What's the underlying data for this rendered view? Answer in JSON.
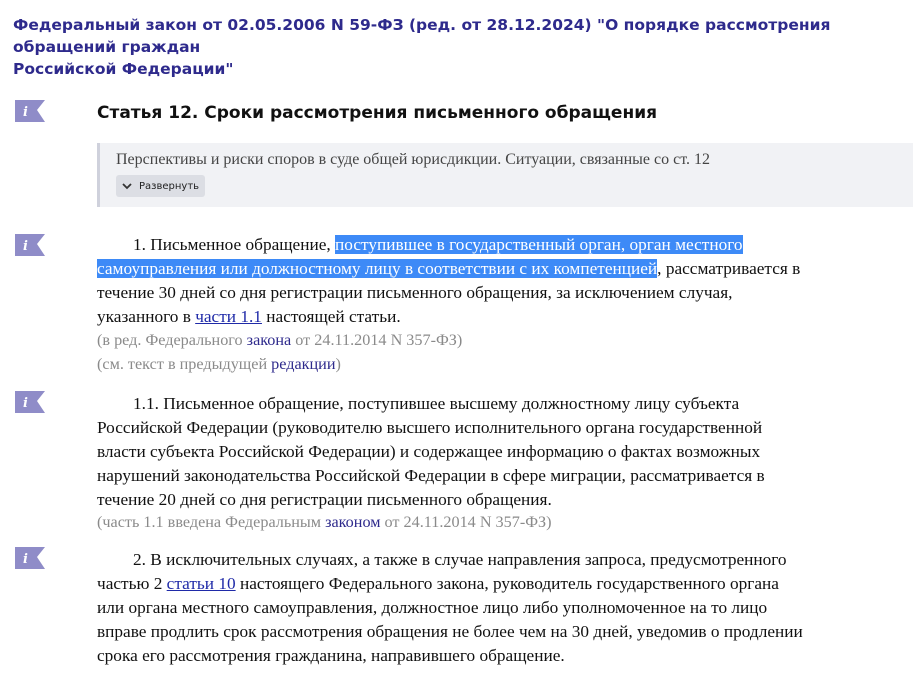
{
  "document": {
    "title_line1": "Федеральный закон от 02.05.2006 N 59-ФЗ (ред. от 28.12.2024) \"О порядке рассмотрения обращений граждан",
    "title_line2": "Российской Федерации\""
  },
  "article": {
    "heading": "Статья 12. Сроки рассмотрения письменного обращения"
  },
  "related": {
    "text": "Перспективы и риски споров в суде общей юрисдикции. Ситуации, связанные со ст. 12",
    "expand_label": "Развернуть"
  },
  "p1": {
    "l1_a": "1. Письменное обращение, ",
    "l1_hl": "поступившее в государственный орган, орган местного",
    "l2_hl": "самоуправления или должностному лицу в соответствии с их компетенцией",
    "l2_b": ", рассматривается в",
    "l3": "течение 30 дней со дня регистрации письменного обращения, за исключением случая,",
    "l4_a": "указанного в ",
    "l4_link": "части 1.1",
    "l4_b": " настоящей статьи.",
    "note1_a": "(в ред. Федерального ",
    "note1_link": "закона",
    "note1_b": " от 24.11.2014 N 357-ФЗ)",
    "note2_a": "(см. текст в предыдущей ",
    "note2_link": "редакции",
    "note2_b": ")"
  },
  "p11": {
    "l1": "1.1. Письменное обращение, поступившее высшему должностному лицу субъекта",
    "l2": "Российской Федерации (руководителю высшего исполнительного органа государственной",
    "l3": "власти субъекта Российской Федерации) и содержащее информацию о фактах возможных",
    "l4": "нарушений законодательства Российской Федерации в сфере миграции, рассматривается в",
    "l5": "течение 20 дней со дня регистрации письменного обращения.",
    "note_a": "(часть 1.1 введена Федеральным ",
    "note_link": "законом",
    "note_b": " от 24.11.2014 N 357-ФЗ)"
  },
  "p2": {
    "l1": "2. В исключительных случаях, а также в случае направления запроса, предусмотренного",
    "l2_a": "частью 2 ",
    "l2_link": "статьи 10",
    "l2_b": " настоящего Федерального закона, руководитель государственного органа",
    "l3": "или органа местного самоуправления, должностное лицо либо уполномоченное на то лицо",
    "l4": "вправе продлить срок рассмотрения обращения не более чем на 30 дней, уведомив о продлении",
    "l5": "срока его рассмотрения гражданина, направившего обращение."
  },
  "colors": {
    "title": "#2e2a8c",
    "icon": "#8f8cc8",
    "highlight": "#3d8af7",
    "link": "#1f2aa8",
    "note": "#8a8a8a"
  }
}
